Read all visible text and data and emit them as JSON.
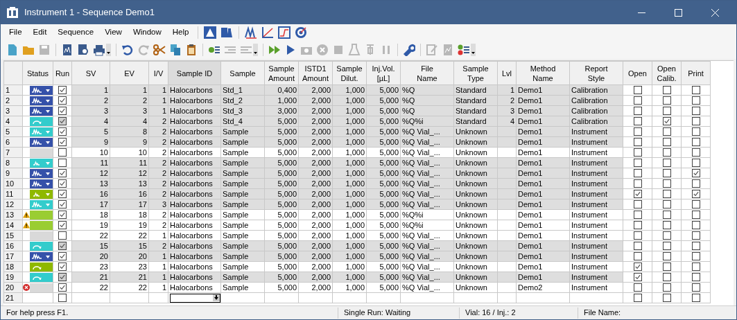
{
  "window": {
    "title": "Instrument 1 - Sequence Demo1"
  },
  "menu": [
    "File",
    "Edit",
    "Sequence",
    "View",
    "Window",
    "Help"
  ],
  "table": {
    "columns": [
      "",
      "Status",
      "Run",
      "SV",
      "EV",
      "I/V",
      "Sample ID",
      "Sample",
      "Sample\nAmount",
      "ISTD1\nAmount",
      "Sample\nDilut.",
      "Inj.Vol.\n[µL]",
      "File\nName",
      "Sample\nType",
      "Lvl",
      "Method\nName",
      "Report\nStyle",
      "Open",
      "Open\nCalib.",
      "Print"
    ],
    "rows": [
      {
        "number": "1",
        "status": {
          "kind": "peaks",
          "color": "#3551a9"
        },
        "run": {
          "checked": true,
          "disabled": false
        },
        "sv": "1",
        "ev": "1",
        "iv": "1",
        "sample_id": "Halocarbons",
        "sample": "Std_1",
        "sample_amount": "0,400",
        "istd1_amount": "2,000",
        "sample_dilut": "1,000",
        "inj_vol": "5,000",
        "file_name": "%Q",
        "sample_type": "Standard",
        "lvl": "1",
        "method_name": "Demo1",
        "report_style": "Calibration",
        "open": false,
        "open_calib": false,
        "print": false,
        "shaded": true
      },
      {
        "number": "2",
        "status": {
          "kind": "peaks",
          "color": "#3551a9"
        },
        "run": {
          "checked": true,
          "disabled": false
        },
        "sv": "2",
        "ev": "2",
        "iv": "1",
        "sample_id": "Halocarbons",
        "sample": "Std_2",
        "sample_amount": "1,000",
        "istd1_amount": "2,000",
        "sample_dilut": "1,000",
        "inj_vol": "5,000",
        "file_name": "%Q",
        "sample_type": "Standard",
        "lvl": "2",
        "method_name": "Demo1",
        "report_style": "Calibration",
        "open": false,
        "open_calib": false,
        "print": false,
        "shaded": true
      },
      {
        "number": "3",
        "status": {
          "kind": "peaks",
          "color": "#3551a9"
        },
        "run": {
          "checked": true,
          "disabled": false
        },
        "sv": "3",
        "ev": "3",
        "iv": "1",
        "sample_id": "Halocarbons",
        "sample": "Std_3",
        "sample_amount": "3,000",
        "istd1_amount": "2,000",
        "sample_dilut": "1,000",
        "inj_vol": "5,000",
        "file_name": "%Q",
        "sample_type": "Standard",
        "lvl": "3",
        "method_name": "Demo1",
        "report_style": "Calibration",
        "open": false,
        "open_calib": false,
        "print": false,
        "shaded": true
      },
      {
        "number": "4",
        "status": {
          "kind": "skip",
          "color": "#33cccc"
        },
        "run": {
          "checked": true,
          "disabled": true
        },
        "sv": "4",
        "ev": "4",
        "iv": "2",
        "sample_id": "Halocarbons",
        "sample": "Std_4",
        "sample_amount": "5,000",
        "istd1_amount": "2,000",
        "sample_dilut": "1,000",
        "inj_vol": "5,000",
        "file_name": "%Q%i",
        "sample_type": "Standard",
        "lvl": "4",
        "method_name": "Demo1",
        "report_style": "Calibration",
        "open": false,
        "open_calib": true,
        "print": false,
        "shaded": true
      },
      {
        "number": "5",
        "status": {
          "kind": "peaks",
          "color": "#33cccc"
        },
        "run": {
          "checked": true,
          "disabled": false
        },
        "sv": "5",
        "ev": "8",
        "iv": "2",
        "sample_id": "Halocarbons",
        "sample": "Sample",
        "sample_amount": "5,000",
        "istd1_amount": "2,000",
        "sample_dilut": "1,000",
        "inj_vol": "5,000",
        "file_name": "%Q Vial_...",
        "sample_type": "Unknown",
        "method_name": "Demo1",
        "report_style": "Instrument",
        "open": false,
        "open_calib": false,
        "print": false,
        "shaded": true
      },
      {
        "number": "6",
        "status": {
          "kind": "peaks",
          "color": "#3551a9"
        },
        "run": {
          "checked": true,
          "disabled": false
        },
        "sv": "9",
        "ev": "9",
        "iv": "2",
        "sample_id": "Halocarbons",
        "sample": "Sample",
        "sample_amount": "5,000",
        "istd1_amount": "2,000",
        "sample_dilut": "1,000",
        "inj_vol": "5,000",
        "file_name": "%Q Vial_...",
        "sample_type": "Unknown",
        "method_name": "Demo1",
        "report_style": "Instrument",
        "open": false,
        "open_calib": false,
        "print": false,
        "shaded": true
      },
      {
        "number": "7",
        "status": {
          "kind": "none",
          "color": "#d9d9d9"
        },
        "run": {
          "checked": false,
          "disabled": false
        },
        "sv": "10",
        "ev": "10",
        "iv": "2",
        "sample_id": "Halocarbons",
        "sample": "Sample",
        "sample_amount": "5,000",
        "istd1_amount": "2,000",
        "sample_dilut": "1,000",
        "inj_vol": "5,000",
        "file_name": "%Q Vial_...",
        "sample_type": "Unknown",
        "method_name": "Demo1",
        "report_style": "Instrument",
        "open": false,
        "open_calib": false,
        "print": false,
        "shaded": false
      },
      {
        "number": "8",
        "status": {
          "kind": "small-peaks",
          "color": "#33cccc"
        },
        "run": {
          "checked": false,
          "disabled": false
        },
        "sv": "11",
        "ev": "11",
        "iv": "2",
        "sample_id": "Halocarbons",
        "sample": "Sample",
        "sample_amount": "5,000",
        "istd1_amount": "2,000",
        "sample_dilut": "1,000",
        "inj_vol": "5,000",
        "file_name": "%Q Vial_...",
        "sample_type": "Unknown",
        "method_name": "Demo1",
        "report_style": "Instrument",
        "open": false,
        "open_calib": false,
        "print": false,
        "shaded": true
      },
      {
        "number": "9",
        "status": {
          "kind": "peaks",
          "color": "#3551a9"
        },
        "run": {
          "checked": true,
          "disabled": false
        },
        "sv": "12",
        "ev": "12",
        "iv": "2",
        "sample_id": "Halocarbons",
        "sample": "Sample",
        "sample_amount": "5,000",
        "istd1_amount": "2,000",
        "sample_dilut": "1,000",
        "inj_vol": "5,000",
        "file_name": "%Q Vial_...",
        "sample_type": "Unknown",
        "method_name": "Demo1",
        "report_style": "Instrument",
        "open": false,
        "open_calib": false,
        "print": true,
        "shaded": true
      },
      {
        "number": "10",
        "status": {
          "kind": "peaks",
          "color": "#3551a9"
        },
        "run": {
          "checked": true,
          "disabled": false
        },
        "sv": "13",
        "ev": "13",
        "iv": "2",
        "sample_id": "Halocarbons",
        "sample": "Sample",
        "sample_amount": "5,000",
        "istd1_amount": "2,000",
        "sample_dilut": "1,000",
        "inj_vol": "5,000",
        "file_name": "%Q Vial_...",
        "sample_type": "Unknown",
        "method_name": "Demo1",
        "report_style": "Instrument",
        "open": false,
        "open_calib": false,
        "print": false,
        "shaded": true
      },
      {
        "number": "11",
        "status": {
          "kind": "small-peaks",
          "color": "#8fb800"
        },
        "run": {
          "checked": true,
          "disabled": false
        },
        "sv": "16",
        "ev": "16",
        "iv": "2",
        "sample_id": "Halocarbons",
        "sample": "Sample",
        "sample_amount": "5,000",
        "istd1_amount": "2,000",
        "sample_dilut": "1,000",
        "inj_vol": "5,000",
        "file_name": "%Q Vial_...",
        "sample_type": "Unknown",
        "method_name": "Demo1",
        "report_style": "Instrument",
        "open": true,
        "open_calib": false,
        "print": true,
        "shaded": true
      },
      {
        "number": "12",
        "status": {
          "kind": "peaks",
          "color": "#33cccc"
        },
        "run": {
          "checked": true,
          "disabled": false
        },
        "sv": "17",
        "ev": "17",
        "iv": "3",
        "sample_id": "Halocarbons",
        "sample": "Sample",
        "sample_amount": "5,000",
        "istd1_amount": "2,000",
        "sample_dilut": "1,000",
        "inj_vol": "5,000",
        "file_name": "%Q Vial_...",
        "sample_type": "Unknown",
        "method_name": "Demo1",
        "report_style": "Instrument",
        "open": false,
        "open_calib": false,
        "print": false,
        "shaded": true
      },
      {
        "number": "13",
        "warning": true,
        "status": {
          "kind": "none",
          "color": "#9acd32"
        },
        "run": {
          "checked": true,
          "disabled": false
        },
        "sv": "18",
        "ev": "18",
        "iv": "2",
        "sample_id": "Halocarbons",
        "sample": "Sample",
        "sample_amount": "5,000",
        "istd1_amount": "2,000",
        "sample_dilut": "1,000",
        "inj_vol": "5,000",
        "file_name": "%Q%i",
        "sample_type": "Unknown",
        "method_name": "Demo1",
        "report_style": "Instrument",
        "open": false,
        "open_calib": false,
        "print": false,
        "shaded": false
      },
      {
        "number": "14",
        "warning": true,
        "status": {
          "kind": "none",
          "color": "#9acd32"
        },
        "run": {
          "checked": true,
          "disabled": false
        },
        "sv": "19",
        "ev": "19",
        "iv": "2",
        "sample_id": "Halocarbons",
        "sample": "Sample",
        "sample_amount": "5,000",
        "istd1_amount": "2,000",
        "sample_dilut": "1,000",
        "inj_vol": "5,000",
        "file_name": "%Q%i",
        "sample_type": "Unknown",
        "method_name": "Demo1",
        "report_style": "Instrument",
        "open": false,
        "open_calib": false,
        "print": false,
        "shaded": false
      },
      {
        "number": "15",
        "status": {
          "kind": "none",
          "color": "#d9d9d9"
        },
        "run": {
          "checked": false,
          "disabled": false
        },
        "sv": "22",
        "ev": "22",
        "iv": "1",
        "sample_id": "Halocarbons",
        "sample": "Sample",
        "sample_amount": "5,000",
        "istd1_amount": "2,000",
        "sample_dilut": "1,000",
        "inj_vol": "5,000",
        "file_name": "%Q Vial_...",
        "sample_type": "Unknown",
        "method_name": "Demo1",
        "report_style": "Instrument",
        "open": false,
        "open_calib": false,
        "print": false,
        "shaded": false
      },
      {
        "number": "16",
        "status": {
          "kind": "skip",
          "color": "#33cccc"
        },
        "run": {
          "checked": true,
          "disabled": true
        },
        "sv": "15",
        "ev": "15",
        "iv": "2",
        "sample_id": "Halocarbons",
        "sample": "Sample",
        "sample_amount": "5,000",
        "istd1_amount": "2,000",
        "sample_dilut": "1,000",
        "inj_vol": "5,000",
        "file_name": "%Q Vial_...",
        "sample_type": "Unknown",
        "method_name": "Demo1",
        "report_style": "Instrument",
        "open": false,
        "open_calib": false,
        "print": false,
        "shaded": true
      },
      {
        "number": "17",
        "status": {
          "kind": "peaks",
          "color": "#3551a9"
        },
        "run": {
          "checked": true,
          "disabled": false
        },
        "sv": "20",
        "ev": "20",
        "iv": "1",
        "sample_id": "Halocarbons",
        "sample": "Sample",
        "sample_amount": "5,000",
        "istd1_amount": "2,000",
        "sample_dilut": "1,000",
        "inj_vol": "5,000",
        "file_name": "%Q Vial_...",
        "sample_type": "Unknown",
        "method_name": "Demo1",
        "report_style": "Instrument",
        "open": false,
        "open_calib": false,
        "print": false,
        "shaded": true
      },
      {
        "number": "18",
        "status": {
          "kind": "skip",
          "color": "#8fb800"
        },
        "run": {
          "checked": true,
          "disabled": false
        },
        "sv": "23",
        "ev": "23",
        "iv": "1",
        "sample_id": "Halocarbons",
        "sample": "Sample",
        "sample_amount": "5,000",
        "istd1_amount": "2,000",
        "sample_dilut": "1,000",
        "inj_vol": "5,000",
        "file_name": "%Q Vial_...",
        "sample_type": "Unknown",
        "method_name": "Demo1",
        "report_style": "Instrument",
        "open": true,
        "open_calib": false,
        "print": false,
        "shaded": false
      },
      {
        "number": "19",
        "status": {
          "kind": "skip",
          "color": "#33cccc"
        },
        "run": {
          "checked": true,
          "disabled": true
        },
        "sv": "21",
        "ev": "21",
        "iv": "1",
        "sample_id": "Halocarbons",
        "sample": "Sample",
        "sample_amount": "5,000",
        "istd1_amount": "2,000",
        "sample_dilut": "1,000",
        "inj_vol": "5,000",
        "file_name": "%Q Vial_...",
        "sample_type": "Unknown",
        "method_name": "Demo1",
        "report_style": "Instrument",
        "open": true,
        "open_calib": false,
        "print": false,
        "shaded": true
      },
      {
        "number": "20",
        "error": true,
        "status": {
          "kind": "none",
          "color": "#d9d9d9"
        },
        "run": {
          "checked": true,
          "disabled": false
        },
        "sv": "22",
        "ev": "22",
        "iv": "1",
        "sample_id": "Halocarbons",
        "sample": "Sample",
        "sample_amount": "5,000",
        "istd1_amount": "2,000",
        "sample_dilut": "1,000",
        "inj_vol": "5,000",
        "file_name": "%Q Vial_...",
        "sample_type": "Unknown",
        "method_name": "Demo2",
        "report_style": "Instrument",
        "open": false,
        "open_calib": false,
        "print": false,
        "shaded": false
      },
      {
        "number": "21",
        "run": {
          "checked": false,
          "disabled": false
        },
        "sample_id_editing": true,
        "open": false,
        "open_calib": false,
        "print": false,
        "shaded": false
      }
    ]
  },
  "status_bar": [
    "For help press F1.",
    "Single Run: Waiting",
    "Vial: 16 / Inj.: 2",
    "File Name:"
  ]
}
